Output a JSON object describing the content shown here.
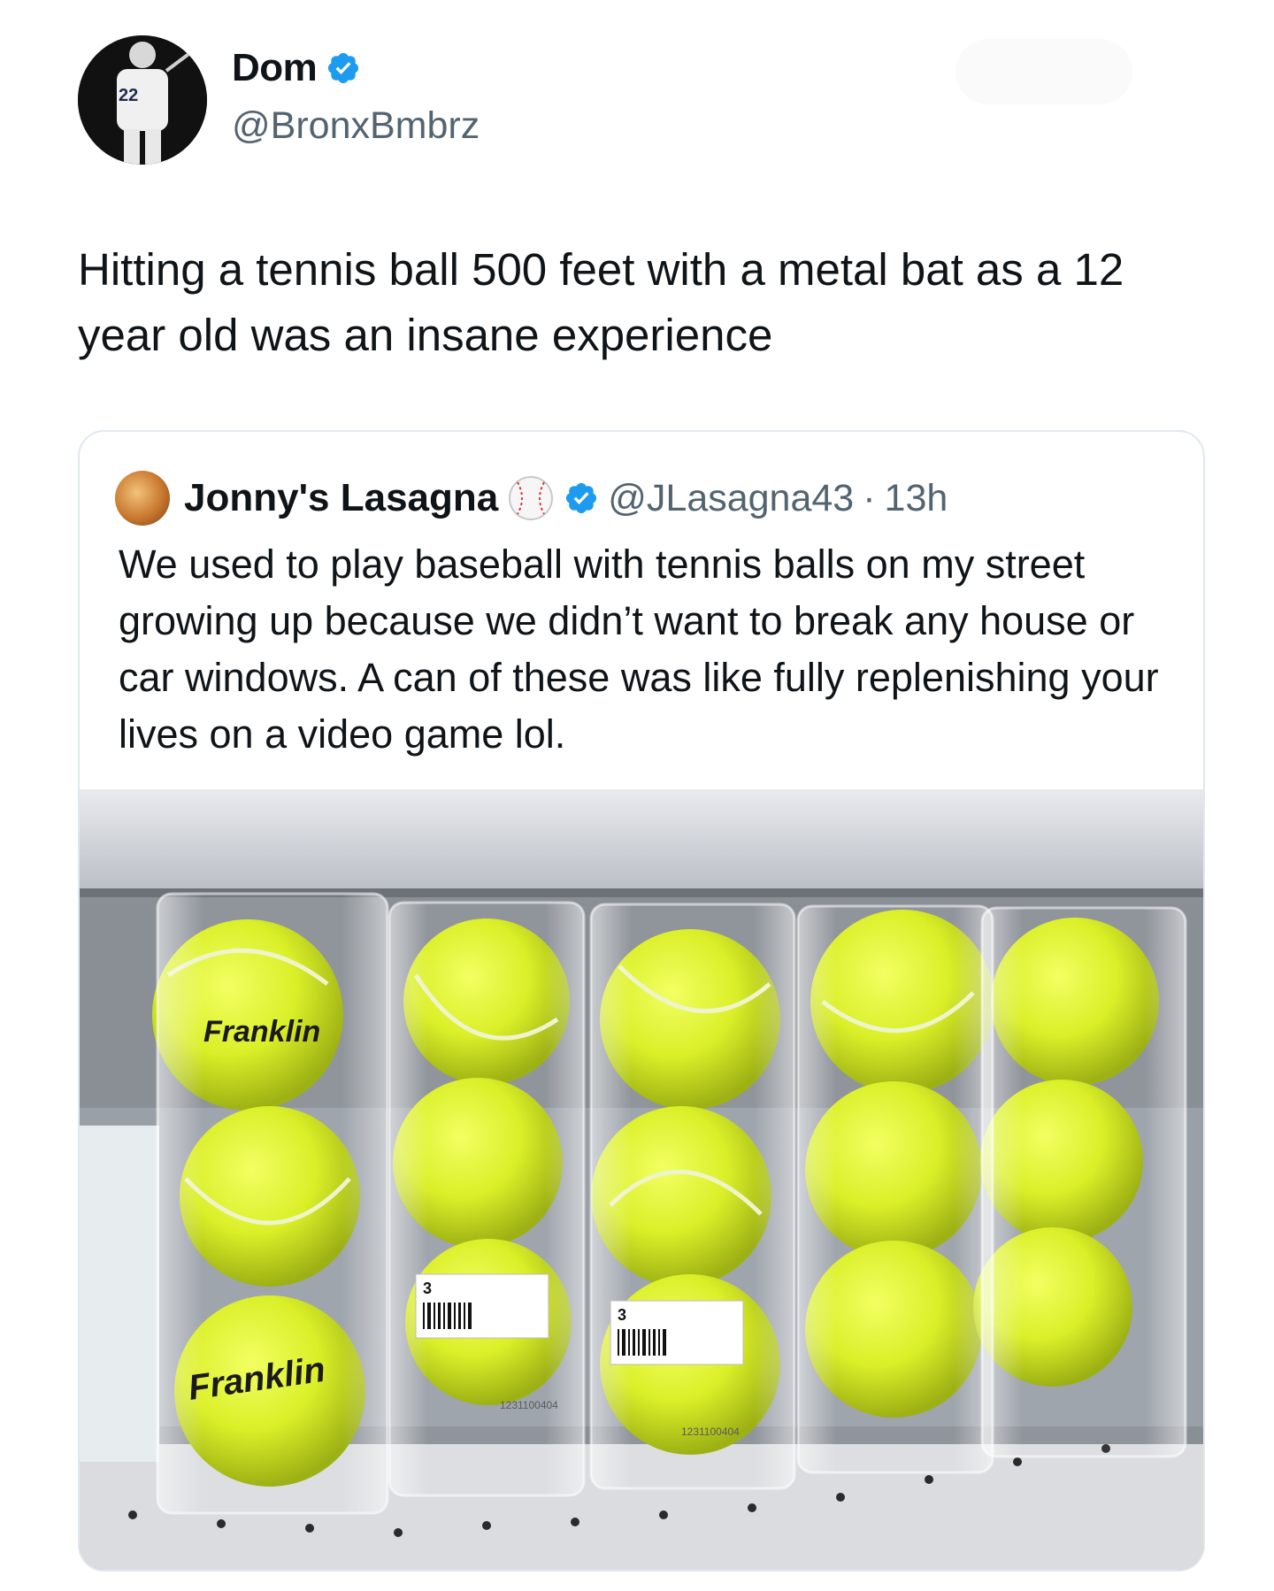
{
  "author": {
    "name": "Dom",
    "handle": "@BronxBmbrz",
    "avatar_jersey_number": "22"
  },
  "tweet": {
    "text": "Hitting a tennis ball 500 feet with a metal bat as a 12 year old was an insane experience"
  },
  "quoted_tweet": {
    "name": "Jonny's Lasagna",
    "handle": "@JLasagna43",
    "separator": "·",
    "time": "13h",
    "text": "We used to play baseball with tennis balls on my street growing up because we didn’t want to break any house or car windows. A can of these was like fully replenishing your lives on a video game lol."
  },
  "photo": {
    "brand_text": "Franklin",
    "barcode_number": "1231100404",
    "pack_label": "3"
  },
  "icons": [
    "verified-badge-icon",
    "baseball-icon"
  ],
  "colors": {
    "verified_blue": "#1d9bf0",
    "handle_gray": "#536471",
    "tennis_ball": "#d8ee1c"
  }
}
